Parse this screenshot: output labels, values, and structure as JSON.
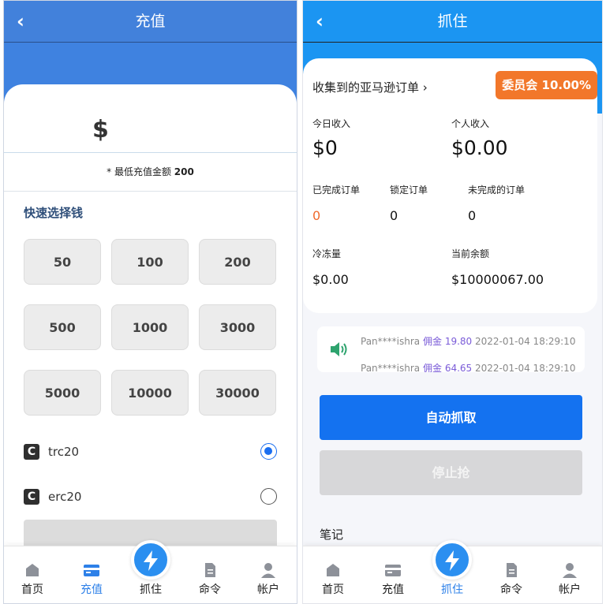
{
  "left": {
    "title": "充值",
    "currency_symbol": "$",
    "min_note_prefix": "* 最低充值金额",
    "min_amount": "200",
    "quick_title": "快速选择钱",
    "amounts": [
      "50",
      "100",
      "200",
      "500",
      "1000",
      "3000",
      "5000",
      "10000",
      "30000"
    ],
    "networks": [
      {
        "label": "trc20",
        "selected": true
      },
      {
        "label": "erc20",
        "selected": false
      }
    ]
  },
  "right": {
    "title": "抓住",
    "collected_label": "收集到的亚马逊订单 ›",
    "badge": "委员会 10.00%",
    "today_income_label": "今日收入",
    "today_income": "$0",
    "personal_income_label": "个人收入",
    "personal_income": "$0.00",
    "completed_label": "已完成订单",
    "completed": "0",
    "locked_label": "锁定订单",
    "locked": "0",
    "unfinished_label": "未完成的订单",
    "unfinished": "0",
    "frozen_label": "冷冻量",
    "frozen": "$0.00",
    "balance_label": "当前余额",
    "balance": "$10000067.00",
    "ticker": [
      {
        "user": "Pan****ishra",
        "commission_label": "佣金",
        "amount": "19.80",
        "time": "2022-01-04 18:29:10"
      },
      {
        "user": "Pan****ishra",
        "commission_label": "佣金",
        "amount": "64.65",
        "time": "2022-01-04 18:29:10"
      }
    ],
    "auto_button": "自动抓取",
    "stop_button": "停止抢",
    "notes_label": "笔记"
  },
  "nav": {
    "items": [
      "首页",
      "充值",
      "抓住",
      "命令",
      "帐户"
    ],
    "left_active": 1,
    "right_active": 2
  },
  "colors": {
    "brand_blue": "#1b95f2",
    "recharge_blue": "#3f82e0",
    "accent_orange": "#f2772a",
    "button_blue": "#1472f0",
    "radio_blue": "#1a6ef0"
  }
}
